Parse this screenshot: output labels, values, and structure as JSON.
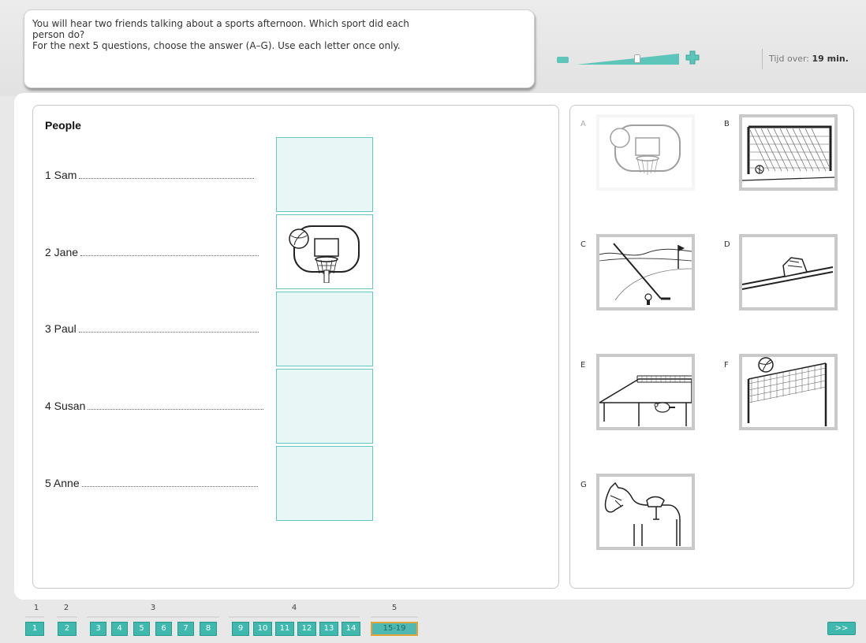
{
  "instructions": {
    "line1": "You will hear two friends talking about a sports afternoon.  Which sport did each",
    "line2": "person do?",
    "line3": "For the next 5 questions, choose the answer (A–G). Use each letter once only."
  },
  "zoom": {
    "level": 0.6,
    "accent_color": "#5ec5bb"
  },
  "timer": {
    "label": "Tijd over:",
    "value": "19 min."
  },
  "people": {
    "title": "People",
    "items": [
      {
        "label": "1 Sam",
        "answer": ""
      },
      {
        "label": "2 Jane",
        "answer": "A"
      },
      {
        "label": "3 Paul",
        "answer": ""
      },
      {
        "label": "4 Susan",
        "answer": ""
      },
      {
        "label": "5 Anne",
        "answer": ""
      }
    ]
  },
  "options": [
    {
      "letter": "A",
      "sport": "basketball-icon",
      "used": true
    },
    {
      "letter": "B",
      "sport": "football-goal-icon",
      "used": false
    },
    {
      "letter": "C",
      "sport": "golf-icon",
      "used": false
    },
    {
      "letter": "D",
      "sport": "skiing-icon",
      "used": false
    },
    {
      "letter": "E",
      "sport": "table-tennis-icon",
      "used": false
    },
    {
      "letter": "F",
      "sport": "volleyball-icon",
      "used": false
    },
    {
      "letter": "G",
      "sport": "horse-riding-icon",
      "used": false
    }
  ],
  "navigation": {
    "groups": [
      "1",
      "2",
      "3",
      "4",
      "5"
    ],
    "buttons": [
      "1",
      "2",
      "3",
      "4",
      "5",
      "6",
      "7",
      "8",
      "9",
      "10",
      "11",
      "12",
      "13",
      "14",
      "15-19"
    ],
    "active": "15-19",
    "next_label": ">>",
    "colors": {
      "button": "#3fb8ad",
      "active_border": "#e0a43a"
    }
  }
}
